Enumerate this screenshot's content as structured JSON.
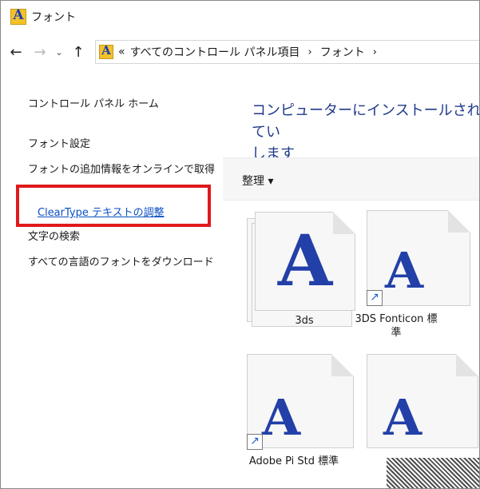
{
  "window": {
    "title": "フォント",
    "app_icon": "font-folder-icon"
  },
  "address": {
    "more": "«",
    "crumbs": [
      "すべてのコントロール パネル項目",
      "フォント"
    ],
    "separator": "›"
  },
  "nav": {
    "back": "←",
    "forward": "→",
    "history": "⌄",
    "up": "↑"
  },
  "sidebar": {
    "items": [
      {
        "label": "コントロール パネル ホーム"
      },
      {
        "label": "フォント設定"
      },
      {
        "label": "フォントの追加情報をオンラインで取得"
      },
      {
        "label": "ClearType テキストの調整"
      },
      {
        "label": "文字の検索"
      },
      {
        "label": "すべての言語のフォントをダウンロード"
      }
    ]
  },
  "content": {
    "heading": "コンピューターにインストールされてい\nします",
    "organize": "整理 ▾"
  },
  "fonts": [
    {
      "name": "3ds",
      "glyph": "A"
    },
    {
      "name": "3DS Fonticon 標準",
      "glyph": "A"
    },
    {
      "name": "Adobe Pi Std 標準",
      "glyph": "A"
    },
    {
      "name": "",
      "glyph": "A"
    }
  ],
  "colors": {
    "highlight": "#e0191c",
    "link": "#0b4fc4",
    "letter": "#2340a8"
  }
}
